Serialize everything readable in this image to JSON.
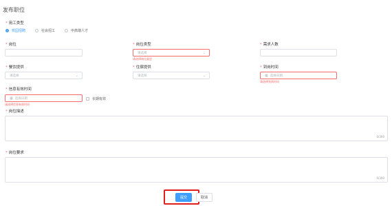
{
  "page": {
    "title": "发布职位"
  },
  "employment_type": {
    "label": "用工类型",
    "options": [
      {
        "label": "校园招聘",
        "checked": true
      },
      {
        "label": "社会招工",
        "checked": false
      },
      {
        "label": "中高端人才",
        "checked": false
      }
    ]
  },
  "fields": {
    "position": {
      "label": "岗位",
      "placeholder": ""
    },
    "position_type": {
      "label": "岗位类型",
      "placeholder": "请选择",
      "error": "请选择岗位类型"
    },
    "headcount": {
      "label": "需求人数",
      "placeholder": ""
    },
    "meal": {
      "label": "餐饮提供",
      "placeholder": "请选择"
    },
    "lodging": {
      "label": "住宿提供",
      "placeholder": "请选择"
    },
    "arrival_time": {
      "label": "到岗时间",
      "placeholder": "选择日期",
      "error": "请选择到岗时间"
    },
    "valid_time": {
      "label": "信息有效时间",
      "placeholder": "选择日期",
      "error": "请选择信息有效时间"
    },
    "long_term": {
      "label": "长期有效",
      "checked": false
    },
    "description": {
      "label": "岗位描述",
      "counter": "0/300"
    },
    "requirements": {
      "label": "岗位要求",
      "counter": "0/300"
    }
  },
  "actions": {
    "submit_label": "提交",
    "cancel_label": "取消"
  },
  "colors": {
    "primary": "#409eff",
    "error": "#f56c6c",
    "highlight": "#e01e1e"
  }
}
